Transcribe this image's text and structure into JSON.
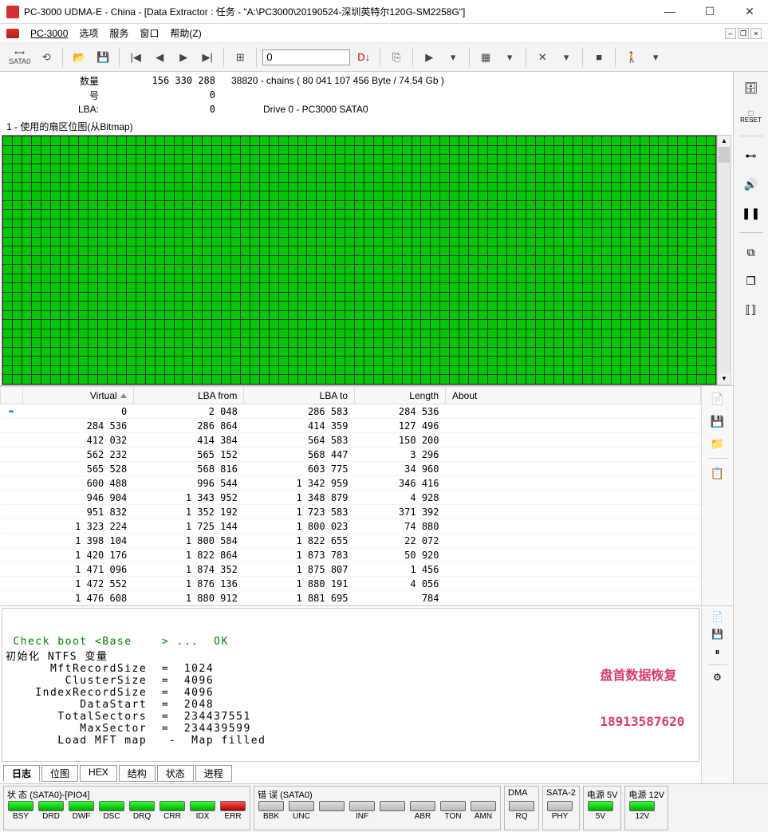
{
  "window": {
    "title": "PC-3000 UDMA-E - China - [Data Extractor : 任务 - \"A:\\PC3000\\20190524-深圳英特尔120G-SM2258G\"]"
  },
  "menu": {
    "app": "PC-3000",
    "items": [
      "选项",
      "服务",
      "窗口",
      "帮助(Z)"
    ]
  },
  "toolbar": {
    "sata_label": "SATA0",
    "lba_value": "0"
  },
  "info": {
    "rows": [
      {
        "label": "数量",
        "value": "156 330 288",
        "extra": "38820 - chains  ( 80 041 107 456 Byte /  74.54 Gb )"
      },
      {
        "label": "号",
        "value": "0",
        "extra": ""
      },
      {
        "label": "LBA:",
        "value": "0",
        "extra": "Drive     0 - PC3000 SATA0",
        "extra_offset": true
      }
    ]
  },
  "bitmap": {
    "title": "1 - 使用的扇区位图(从Bitmap)"
  },
  "table": {
    "headers": {
      "virtual": "Virtual",
      "lba_from": "LBA from",
      "lba_to": "LBA to",
      "length": "Length",
      "about": "About"
    },
    "rows": [
      {
        "v": "0",
        "f": "2 048",
        "t": "286 583",
        "l": "284 536",
        "first": true
      },
      {
        "v": "284 536",
        "f": "286 864",
        "t": "414 359",
        "l": "127 496"
      },
      {
        "v": "412 032",
        "f": "414 384",
        "t": "564 583",
        "l": "150 200"
      },
      {
        "v": "562 232",
        "f": "565 152",
        "t": "568 447",
        "l": "3 296"
      },
      {
        "v": "565 528",
        "f": "568 816",
        "t": "603 775",
        "l": "34 960"
      },
      {
        "v": "600 488",
        "f": "996 544",
        "t": "1 342 959",
        "l": "346 416"
      },
      {
        "v": "946 904",
        "f": "1 343 952",
        "t": "1 348 879",
        "l": "4 928"
      },
      {
        "v": "951 832",
        "f": "1 352 192",
        "t": "1 723 583",
        "l": "371 392"
      },
      {
        "v": "1 323 224",
        "f": "1 725 144",
        "t": "1 800 023",
        "l": "74 880"
      },
      {
        "v": "1 398 104",
        "f": "1 800 584",
        "t": "1 822 655",
        "l": "22 072"
      },
      {
        "v": "1 420 176",
        "f": "1 822 864",
        "t": "1 873 783",
        "l": "50 920"
      },
      {
        "v": "1 471 096",
        "f": "1 874 352",
        "t": "1 875 807",
        "l": "1 456"
      },
      {
        "v": "1 472 552",
        "f": "1 876 136",
        "t": "1 880 191",
        "l": "4 056"
      },
      {
        "v": "1 476 608",
        "f": "1 880 912",
        "t": "1 881 695",
        "l": "784"
      }
    ]
  },
  "log": {
    "lines": [
      {
        "text": " Check boot <Base    > ...  OK",
        "cls": "green"
      },
      {
        "text": "初始化 NTFS 变量",
        "cls": ""
      },
      {
        "text": "      MftRecordSize  =  1024",
        "cls": ""
      },
      {
        "text": "        ClusterSize  =  4096",
        "cls": ""
      },
      {
        "text": "    IndexRecordSize  =  4096",
        "cls": ""
      },
      {
        "text": "          DataStart  =  2048",
        "cls": ""
      },
      {
        "text": "       TotalSectors  =  234437551",
        "cls": ""
      },
      {
        "text": "          MaxSector  =  234439599",
        "cls": ""
      },
      {
        "text": "       Load MFT map   -  Map filled",
        "cls": ""
      }
    ],
    "watermark1": "盘首数据恢复",
    "watermark2": "18913587620",
    "tabs": [
      "日志",
      "位图",
      "HEX",
      "结构",
      "状态",
      "进程"
    ]
  },
  "status": {
    "groups": [
      {
        "hdr": "状 态 (SATA0)-[PIO4]",
        "leds": [
          {
            "c": "green",
            "l": "BSY"
          },
          {
            "c": "green",
            "l": "DRD"
          },
          {
            "c": "green",
            "l": "DWF"
          },
          {
            "c": "green",
            "l": "DSC"
          },
          {
            "c": "green",
            "l": "DRQ"
          },
          {
            "c": "green",
            "l": "CRR"
          },
          {
            "c": "green",
            "l": "IDX"
          },
          {
            "c": "red",
            "l": "ERR"
          }
        ]
      },
      {
        "hdr": "错 误 (SATA0)",
        "leds": [
          {
            "c": "gray",
            "l": "BBK"
          },
          {
            "c": "gray",
            "l": "UNC"
          },
          {
            "c": "gray",
            "l": ""
          },
          {
            "c": "gray",
            "l": "INF"
          },
          {
            "c": "gray",
            "l": ""
          },
          {
            "c": "gray",
            "l": "ABR"
          },
          {
            "c": "gray",
            "l": "TON"
          },
          {
            "c": "gray",
            "l": "AMN"
          }
        ]
      },
      {
        "hdr": "DMA",
        "leds": [
          {
            "c": "gray",
            "l": "RQ"
          }
        ]
      },
      {
        "hdr": "SATA-2",
        "leds": [
          {
            "c": "gray",
            "l": "PHY"
          }
        ]
      },
      {
        "hdr": "电源 5V",
        "leds": [
          {
            "c": "green",
            "l": "5V"
          }
        ]
      },
      {
        "hdr": "电源 12V",
        "leds": [
          {
            "c": "green",
            "l": "12V"
          }
        ]
      }
    ]
  }
}
